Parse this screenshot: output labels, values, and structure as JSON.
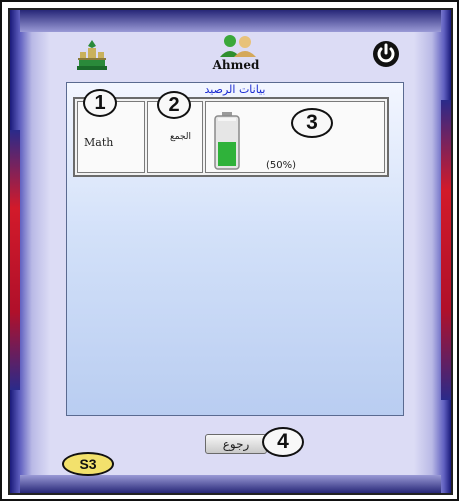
{
  "header": {
    "username": "Ahmed"
  },
  "panel": {
    "title": "بيانات الرصيد",
    "row": {
      "subject": "Math",
      "total_label": "الجمع",
      "battery_percent_text": "(50%)",
      "battery_level": 0.5
    }
  },
  "footer": {
    "back_label": "رجوع"
  },
  "annotations": {
    "c1": "1",
    "c2": "2",
    "c3": "3",
    "c4": "4",
    "screen_id": "S3"
  },
  "icons": {
    "logo": "university-logo-icon",
    "avatar": "users-avatar-icon",
    "power": "power-icon",
    "battery": "battery-icon"
  },
  "colors": {
    "frame": "#2a2a8a",
    "accent_red": "#d21a2a",
    "panel_title": "#1a2ad0",
    "battery_green": "#2fb23a",
    "s3_badge": "#f2e16c"
  }
}
